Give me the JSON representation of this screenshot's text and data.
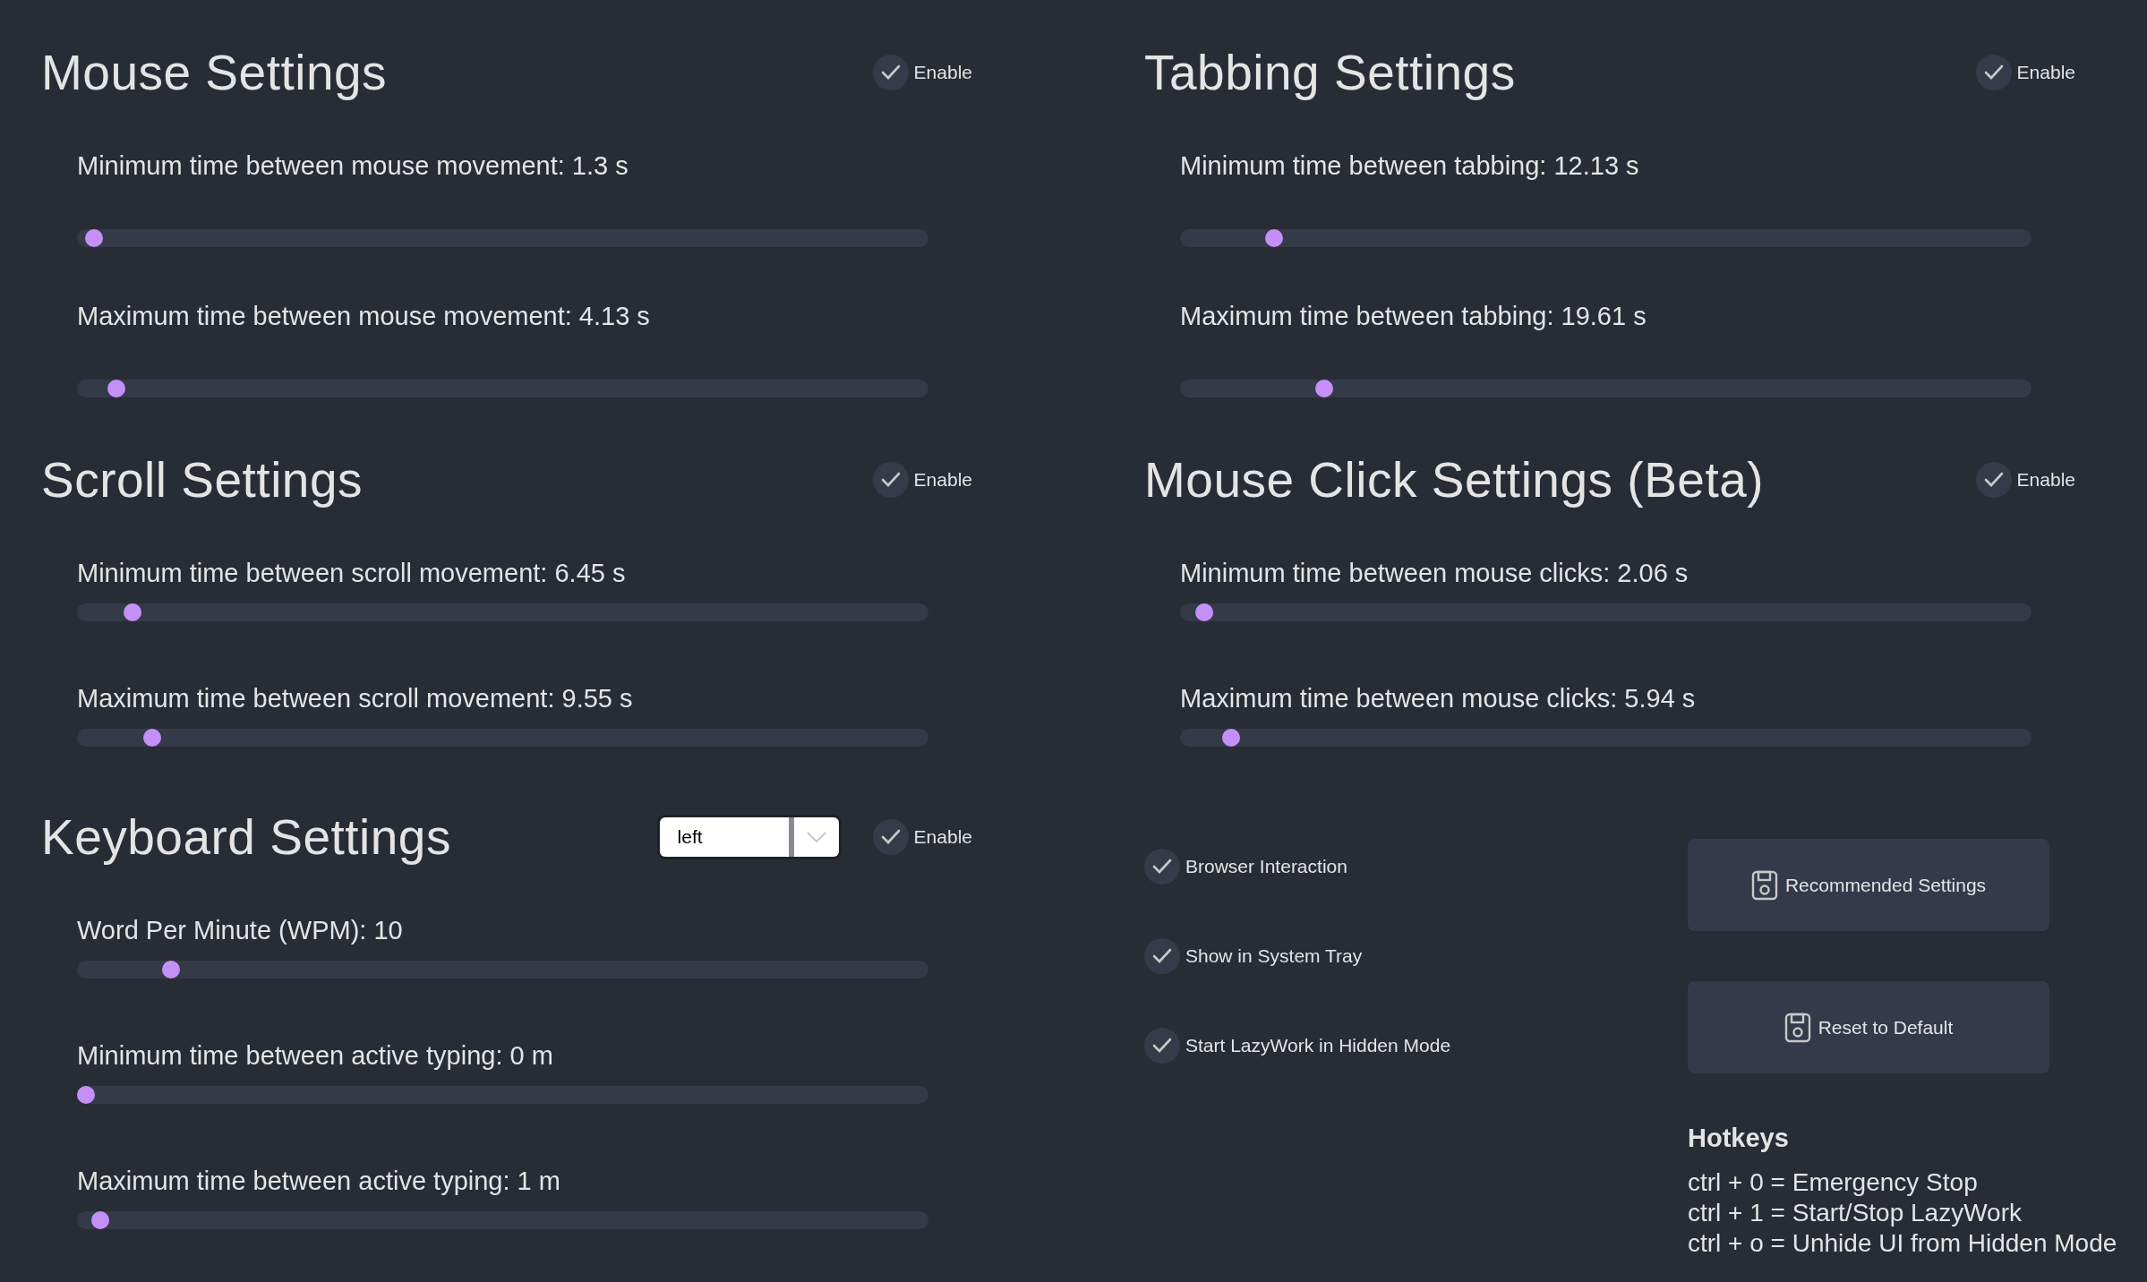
{
  "left_column": {
    "sections": [
      {
        "title": "Mouse Settings",
        "enabled": true,
        "enable_label": "Enable",
        "sliders": [
          {
            "label": "Minimum time between mouse movement: 1.3 s",
            "level": 0.01
          },
          {
            "label": "Maximum time between mouse movement: 4.13 s",
            "level": 0.036
          }
        ]
      },
      {
        "title": "Scroll Settings",
        "enabled": true,
        "enable_label": "Enable",
        "sliders": [
          {
            "label": "Minimum time between scroll movement: 6.45 s",
            "level": 0.056
          },
          {
            "label": "Maximum time between scroll movement: 9.55 s",
            "level": 0.08
          }
        ]
      },
      {
        "title": "Keyboard Settings",
        "enabled": true,
        "enable_label": "Enable",
        "dropdown": {
          "value": "left"
        },
        "sliders": [
          {
            "label": "Word Per Minute (WPM): 10",
            "level": 0.102
          },
          {
            "label": "Minimum time between active typing: 0 m",
            "level": 0.0
          },
          {
            "label": "Maximum time between active typing: 1 m",
            "level": 0.017
          }
        ]
      }
    ]
  },
  "right_column": {
    "sections": [
      {
        "title": "Tabbing Settings",
        "enabled": true,
        "enable_label": "Enable",
        "sliders": [
          {
            "label": "Minimum time between tabbing: 12.13 s",
            "level": 0.102
          },
          {
            "label": "Maximum time between tabbing: 19.61 s",
            "level": 0.162
          }
        ]
      },
      {
        "title": "Mouse Click Settings (Beta)",
        "enabled": true,
        "enable_label": "Enable",
        "sliders": [
          {
            "label": "Minimum time between mouse clicks: 2.06 s",
            "level": 0.018
          },
          {
            "label": "Maximum time between mouse clicks: 5.94 s",
            "level": 0.05
          }
        ]
      }
    ],
    "options": [
      {
        "label": "Browser Interaction",
        "checked": true
      },
      {
        "label": "Show in System Tray",
        "checked": true
      },
      {
        "label": "Start LazyWork in Hidden Mode",
        "checked": true
      }
    ],
    "buttons": [
      {
        "label": "Recommended Settings"
      },
      {
        "label": "Reset to Default"
      }
    ],
    "hotkeys": {
      "title": "Hotkeys",
      "lines": [
        "ctrl + 0 = Emergency Stop",
        "ctrl + 1 = Start/Stop LazyWork",
        "ctrl + o = Unhide UI from Hidden Mode"
      ]
    }
  }
}
